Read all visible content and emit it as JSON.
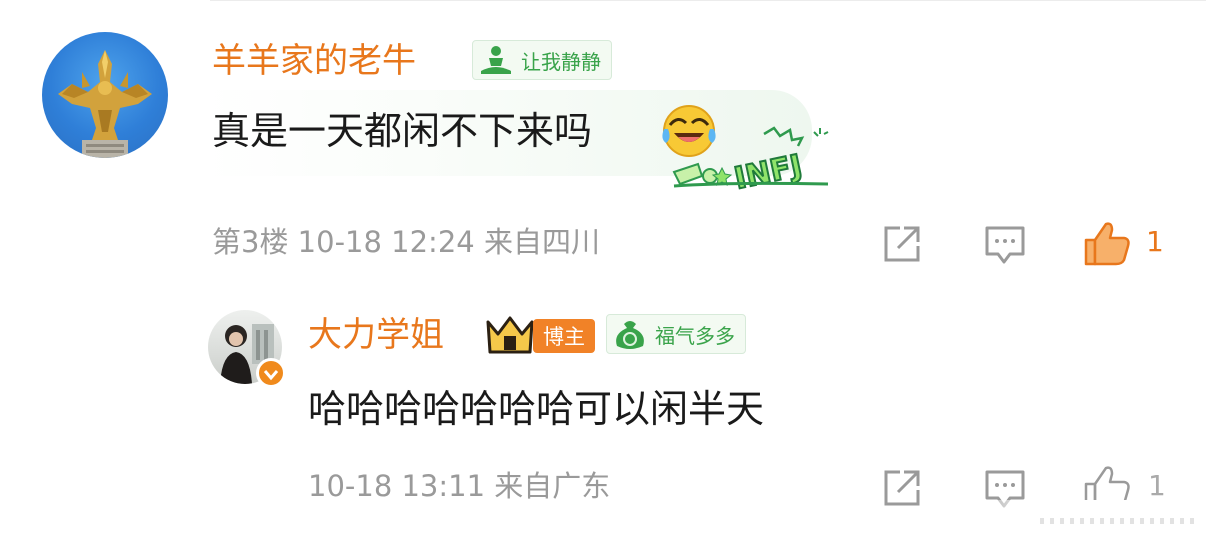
{
  "comment": {
    "username": "羊羊家的老牛",
    "badge_label": "让我静静",
    "text": "真是一天都闲不下来吗",
    "meta": "第3楼 10-18 12:24 来自四川",
    "like_count": "1",
    "sticker_text": "INFJ",
    "avatar_icon": "golden-garuda-statue",
    "emoji_icon": "laugh-cry-emoji"
  },
  "reply": {
    "username": "大力学姐",
    "role_tag": "博主",
    "badge_label": "福气多多",
    "text": "哈哈哈哈哈哈哈可以闲半天",
    "meta": "10-18 13:11 来自广东",
    "like_count": "1",
    "avatar_icon": "user-photo-avatar"
  },
  "colors": {
    "accent_orange": "#e8771c",
    "badge_green": "#39a34a",
    "meta_gray": "#9a9a9a"
  }
}
